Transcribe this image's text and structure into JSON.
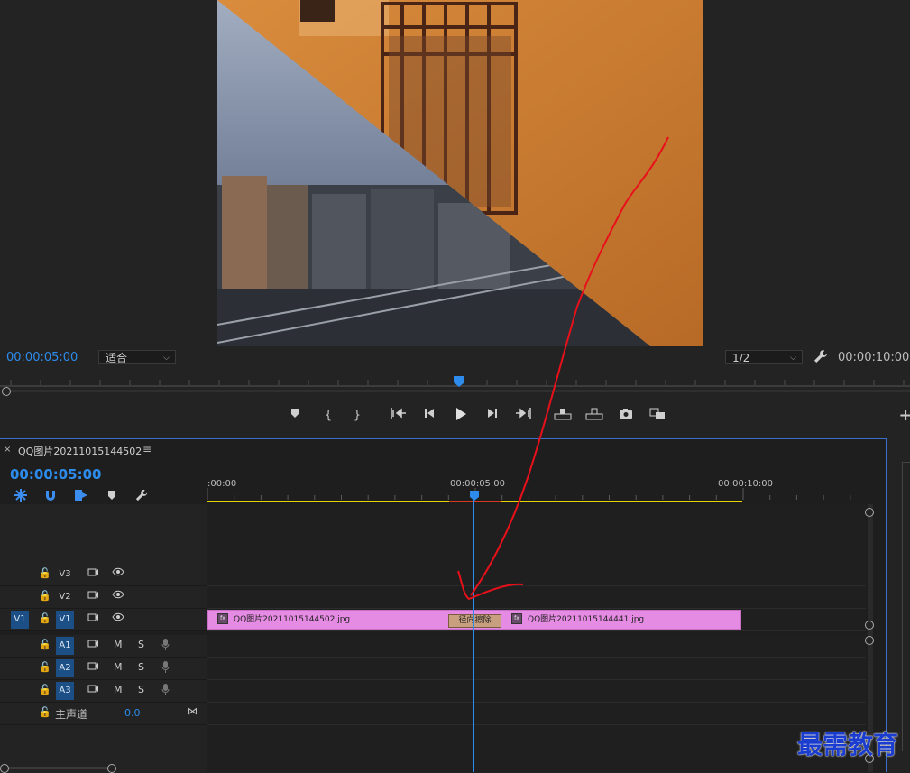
{
  "monitor": {
    "left_timecode": "00:00:05:00",
    "fit_select": "适合",
    "quality_select": "1/2",
    "right_timecode": "00:00:10:00"
  },
  "transport": {
    "icons": [
      "marker-icon",
      "mark-in-icon",
      "mark-out-icon",
      "go-to-in-icon",
      "step-back-icon",
      "play-icon",
      "step-forward-icon",
      "go-to-out-icon",
      "lift-icon",
      "extract-icon",
      "camera-icon",
      "comparison-icon",
      "add-icon"
    ]
  },
  "sequence": {
    "close": "×",
    "name": "QQ图片20211015144502",
    "menu": "≡",
    "timecode": "00:00:05:00"
  },
  "ruler": {
    "labels": [
      ":00:00",
      "00:00:05:00",
      "00:00:10:00"
    ]
  },
  "tracks": {
    "video": [
      {
        "name": "V3",
        "source": ""
      },
      {
        "name": "V2",
        "source": ""
      },
      {
        "name": "V1",
        "source": "V1"
      }
    ],
    "audio": [
      {
        "name": "A1",
        "m": "M",
        "s": "S"
      },
      {
        "name": "A2",
        "m": "M",
        "s": "S"
      },
      {
        "name": "A3",
        "m": "M",
        "s": "S"
      }
    ],
    "master": {
      "label": "主声道",
      "value": "0.0"
    }
  },
  "clips": {
    "clip1": "QQ图片20211015144502.jpg",
    "transition": "径向擦除",
    "clip2": "QQ图片20211015144441.jpg",
    "fx": "fx"
  },
  "watermark": "最需教育",
  "colors": {
    "accent": "#2d8ceb",
    "clip": "#e68be3",
    "annotation": "#e8101a",
    "work_area": "#e5d400"
  }
}
